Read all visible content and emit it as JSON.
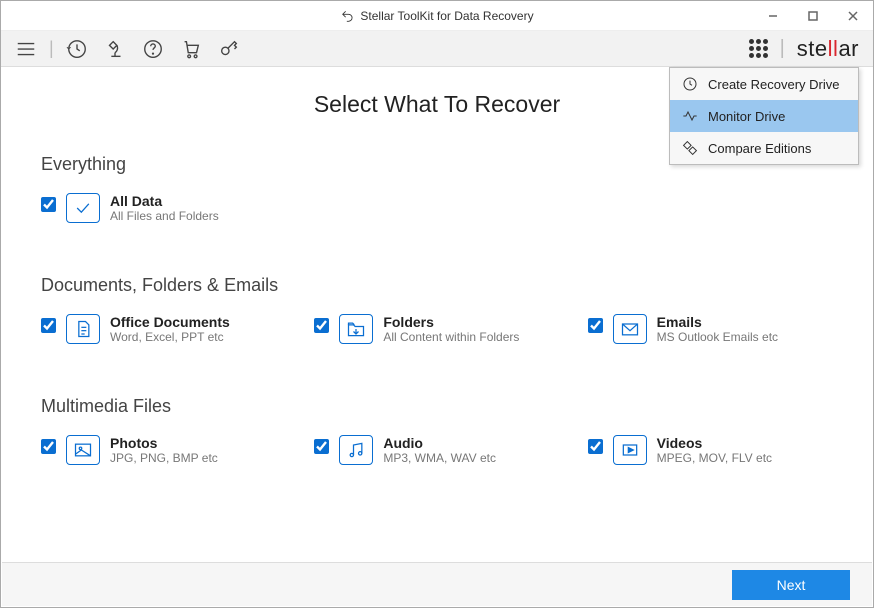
{
  "window": {
    "title": "Stellar ToolKit for Data Recovery"
  },
  "brand": {
    "prefix": "ste",
    "accent": "ll",
    "suffix": "ar"
  },
  "page": {
    "title": "Select What To Recover"
  },
  "sections": {
    "everything": {
      "title": "Everything"
    },
    "documents": {
      "title": "Documents, Folders & Emails"
    },
    "multimedia": {
      "title": "Multimedia Files"
    }
  },
  "items": {
    "alldata": {
      "title": "All Data",
      "sub": "All Files and Folders"
    },
    "office": {
      "title": "Office Documents",
      "sub": "Word, Excel, PPT etc"
    },
    "folders": {
      "title": "Folders",
      "sub": "All Content within Folders"
    },
    "emails": {
      "title": "Emails",
      "sub": "MS Outlook Emails etc"
    },
    "photos": {
      "title": "Photos",
      "sub": "JPG, PNG, BMP etc"
    },
    "audio": {
      "title": "Audio",
      "sub": "MP3, WMA, WAV etc"
    },
    "videos": {
      "title": "Videos",
      "sub": "MPEG, MOV, FLV etc"
    }
  },
  "dropdown": {
    "items": [
      {
        "label": "Create Recovery Drive"
      },
      {
        "label": "Monitor Drive"
      },
      {
        "label": "Compare Editions"
      }
    ]
  },
  "footer": {
    "next": "Next"
  }
}
